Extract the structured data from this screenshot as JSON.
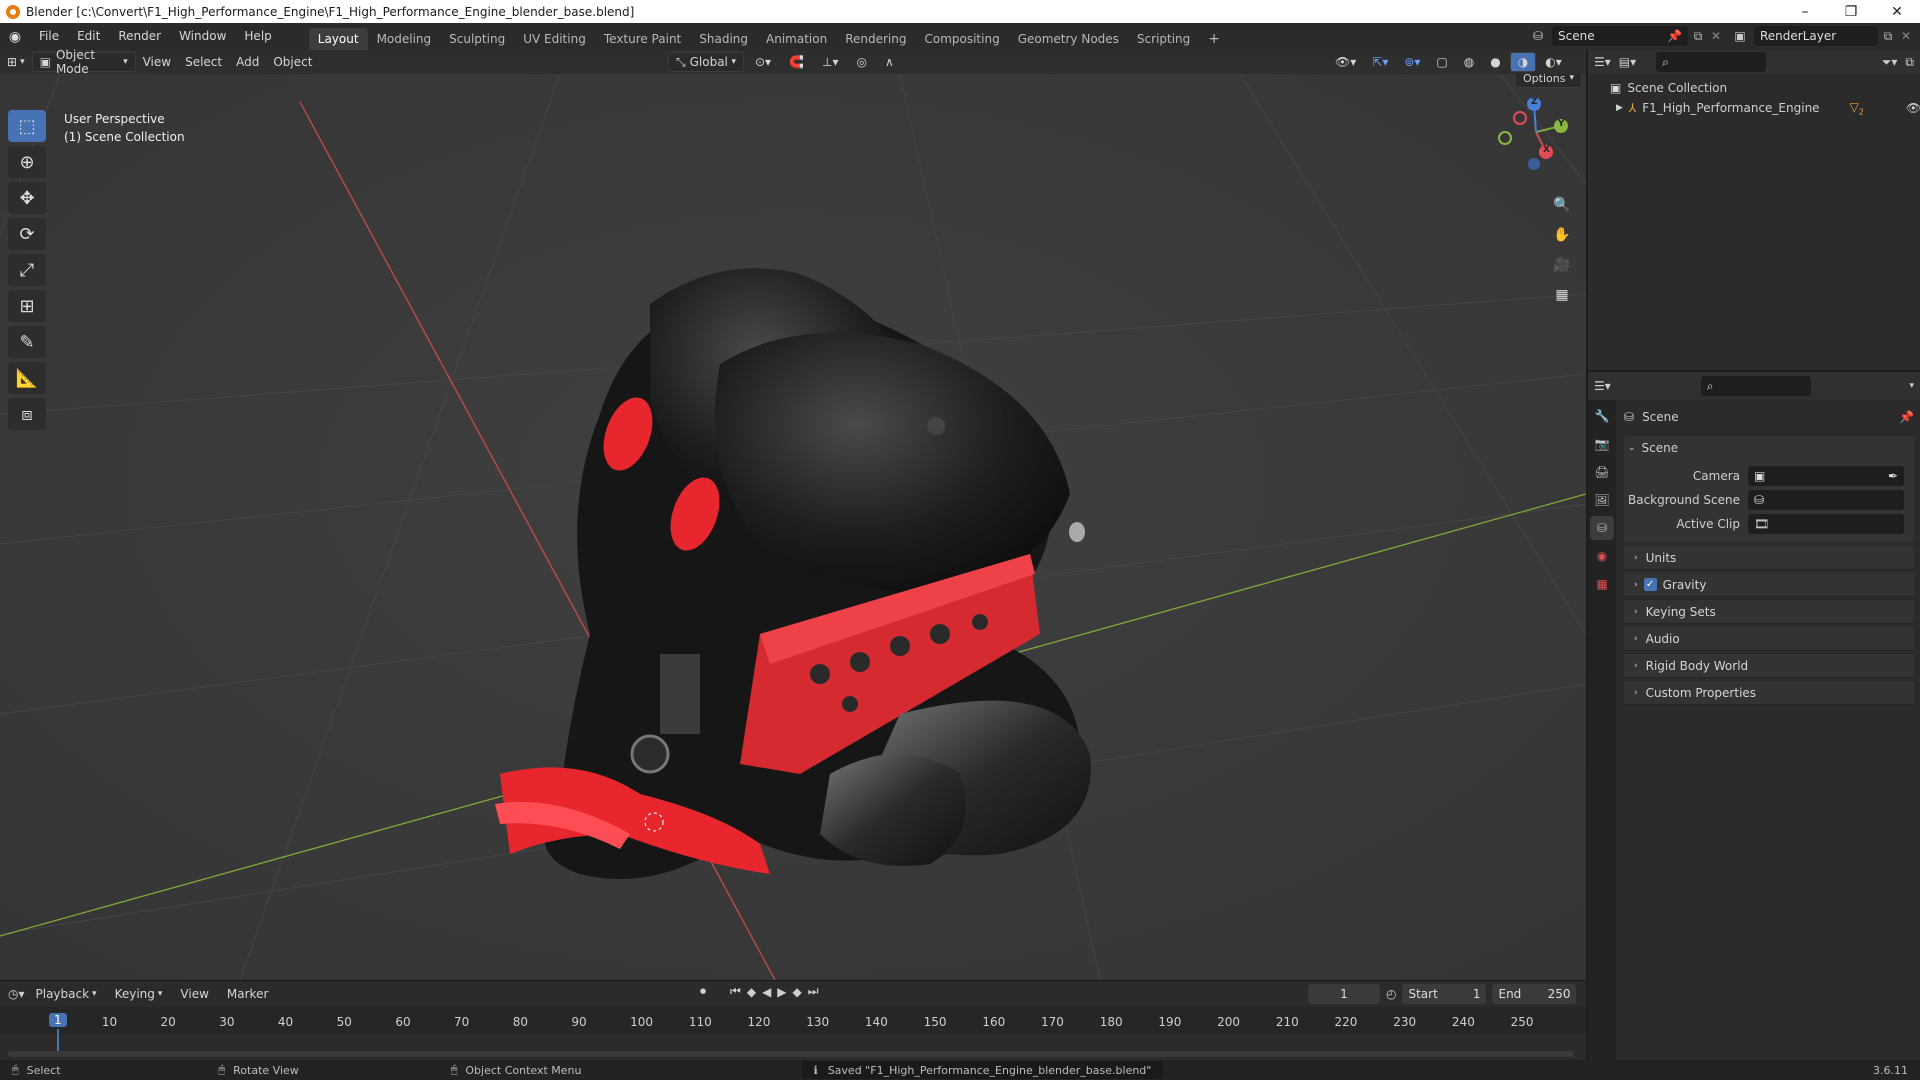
{
  "window": {
    "title": "Blender [c:\\Convert\\F1_High_Performance_Engine\\F1_High_Performance_Engine_blender_base.blend]",
    "minimize": "–",
    "maximize": "❐",
    "close": "✕"
  },
  "menus": [
    "File",
    "Edit",
    "Render",
    "Window",
    "Help"
  ],
  "workspaces": [
    "Layout",
    "Modeling",
    "Sculpting",
    "UV Editing",
    "Texture Paint",
    "Shading",
    "Animation",
    "Rendering",
    "Compositing",
    "Geometry Nodes",
    "Scripting"
  ],
  "add_workspace": "+",
  "scene_selector": {
    "value": "Scene"
  },
  "renderlayer_selector": {
    "value": "RenderLayer"
  },
  "viewport_header": {
    "mode": "Object Mode",
    "menus": [
      "View",
      "Select",
      "Add",
      "Object"
    ],
    "orientation": "Global",
    "options": "Options"
  },
  "viewport_overlay": {
    "perspective": "User Perspective",
    "collection": "(1) Scene Collection"
  },
  "gizmo": {
    "x": "X",
    "y": "Y",
    "z": "Z"
  },
  "outliner": {
    "root": "Scene Collection",
    "items": [
      {
        "label": "F1_High_Performance_Engine",
        "badge": "2"
      }
    ]
  },
  "properties": {
    "context_title": "Scene",
    "section_title": "Scene",
    "fields": [
      {
        "label": "Camera",
        "value": ""
      },
      {
        "label": "Background Scene",
        "value": ""
      },
      {
        "label": "Active Clip",
        "value": ""
      }
    ],
    "panels": [
      {
        "label": "Units",
        "checkbox": false
      },
      {
        "label": "Gravity",
        "checkbox": true
      },
      {
        "label": "Keying Sets",
        "checkbox": false
      },
      {
        "label": "Audio",
        "checkbox": false
      },
      {
        "label": "Rigid Body World",
        "checkbox": false
      },
      {
        "label": "Custom Properties",
        "checkbox": false
      }
    ]
  },
  "timeline": {
    "menus": [
      "Playback",
      "Keying",
      "View",
      "Marker"
    ],
    "current_frame": "1",
    "start_label": "Start",
    "start": "1",
    "end_label": "End",
    "end": "250",
    "ticks": [
      "1",
      "10",
      "20",
      "30",
      "40",
      "50",
      "60",
      "70",
      "80",
      "90",
      "100",
      "110",
      "120",
      "130",
      "140",
      "150",
      "160",
      "170",
      "180",
      "190",
      "200",
      "210",
      "220",
      "230",
      "240",
      "250"
    ]
  },
  "status": {
    "select": "Select",
    "rotate": "Rotate View",
    "context_menu": "Object Context Menu",
    "message": "Saved \"F1_High_Performance_Engine_blender_base.blend\"",
    "version": "3.6.11"
  },
  "colors": {
    "accent": "#4772b3",
    "engine_red": "#e8262e",
    "x_axis": "#c84b4b",
    "y_axis": "#7fa83a"
  }
}
